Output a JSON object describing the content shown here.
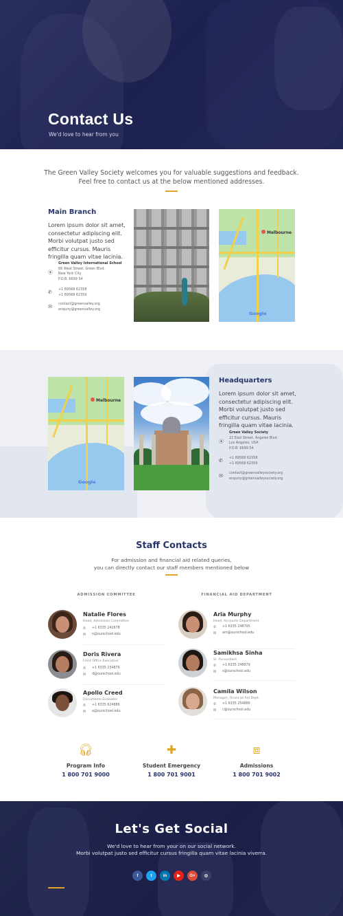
{
  "hero": {
    "title": "Contact Us",
    "subtitle": "We'd love to hear from you"
  },
  "intro": {
    "line1": "The Green Valley Society welcomes you for valuable suggestions and feedback.",
    "line2": "Feel free to contact us at the below mentioned addresses."
  },
  "main_branch": {
    "title": "Main Branch",
    "text_lines": [
      "Lorem ipsum dolor sit amet,",
      "consectetur adipiscing elit.",
      "Morbi volutpat justo sed",
      "efficitur cursus. Mauris",
      "fringilla quam vitae lacinia."
    ],
    "address": {
      "name": "Green Valley International School",
      "street": "66 West Street, Green Blvd.",
      "city": "New York City",
      "po": "P.O.B. 6699 54"
    },
    "phones": [
      "+1 89568 62358",
      "+1 89568 62359"
    ],
    "emails": [
      "contact@greenvalley.org",
      "enquiry@greenvalley.org"
    ],
    "map": {
      "city_label": "Melbourne",
      "brand": "Google"
    }
  },
  "headquarters": {
    "title": "Headquarters",
    "text_lines": [
      "Lorem ipsum dolor sit amet,",
      "consectetur adipiscing elit.",
      "Morbi volutpat justo sed",
      "efficitur cursus. Mauris",
      "fringilla quam vitae lacinia."
    ],
    "address": {
      "name": "Green Valley Society",
      "street": "22 East Street, Angeles Blvd.",
      "city": "Los Angeles, USA",
      "po": "P.O.B. 6699 54"
    },
    "phones": [
      "+1 89568 62358",
      "+1 89568 62359"
    ],
    "emails": [
      "contact@greenvalleysociety.org",
      "enquiry@greenvalleysociety.org"
    ],
    "map": {
      "city_label": "Melbourne",
      "brand": "Google"
    }
  },
  "staff": {
    "title": "Staff Contacts",
    "sub1": "For admission and financial aid related queries,",
    "sub2": "you can directly contact our staff members mentioned below",
    "left_dept": "ADMISSION COMMITTEE",
    "right_dept": "FINANCIAL AID DEPARTMENT",
    "left": [
      {
        "name": "Natalie Flores",
        "role": "Head, Admission Committee",
        "phone": "+1 6335 242678",
        "email": "n@ourschool.edu"
      },
      {
        "name": "Doris Rivera",
        "role": "Front Office Executive",
        "phone": "+1 6335 234879",
        "email": "d@ourschool.edu"
      },
      {
        "name": "Apollo Creed",
        "role": "Documents Evaluator",
        "phone": "+1 6335 624886",
        "email": "a@ourschool.edu"
      }
    ],
    "right": [
      {
        "name": "Aria Murphy",
        "role": "Head, Accounts Department",
        "phone": "+1 6335 248795",
        "email": "am@ourschool.edu"
      },
      {
        "name": "Samikhsa Sinha",
        "role": "Sr. Accountant",
        "phone": "+1 6335 248879",
        "email": "s@ourschool.edu"
      },
      {
        "name": "Camila Wilson",
        "role": "Manager, Financial Aid Dept.",
        "phone": "+1 6335 254886",
        "email": "c@ourschool.edu"
      }
    ]
  },
  "info": [
    {
      "label": "Program Info",
      "number": "1 800 701 9000",
      "icon": "headphones-icon"
    },
    {
      "label": "Student Emergency",
      "number": "1 800 701 9001",
      "icon": "first-aid-icon"
    },
    {
      "label": "Admissions",
      "number": "1 800 701 9002",
      "icon": "gift-icon"
    }
  ],
  "social": {
    "title": "Let's Get Social",
    "sub1": "We'd love to hear from your on our social network.",
    "sub2": "Morbi volutpat justo sed efficitur cursus fringilla quam vitae lacinia viverra.",
    "buttons": [
      {
        "label": "f",
        "color": "#3b5998",
        "icon": "facebook-icon"
      },
      {
        "label": "t",
        "color": "#1da1f2",
        "icon": "twitter-icon"
      },
      {
        "label": "in",
        "color": "#0077b5",
        "icon": "linkedin-icon"
      },
      {
        "label": "▶",
        "color": "#e62117",
        "icon": "youtube-icon"
      },
      {
        "label": "G+",
        "color": "#dd4b39",
        "icon": "google-plus-icon"
      },
      {
        "label": "◎",
        "color": "#3a3f63",
        "icon": "instagram-icon"
      }
    ]
  },
  "colors": {
    "navy": "#28356b",
    "gold": "#e0a726"
  }
}
